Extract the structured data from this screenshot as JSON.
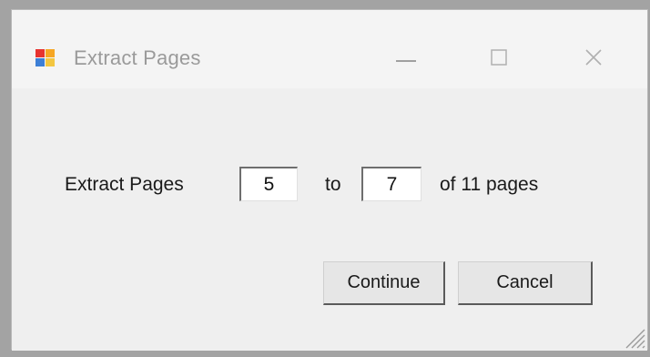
{
  "window": {
    "title": "Extract Pages",
    "app_icon": "application-icon",
    "controls": {
      "minimize_icon": "minimize-icon",
      "maximize_icon": "maximize-icon",
      "close_icon": "close-icon"
    }
  },
  "form": {
    "extract_label": "Extract Pages",
    "from_value": "5",
    "to_label": "to",
    "to_value": "7",
    "of_label": "of 11 pages"
  },
  "buttons": {
    "continue_label": "Continue",
    "cancel_label": "Cancel"
  },
  "colors": {
    "window_bg": "#efefef",
    "title_text": "#9a9a9a",
    "text": "#1a1a1a",
    "input_bg": "#ffffff"
  }
}
